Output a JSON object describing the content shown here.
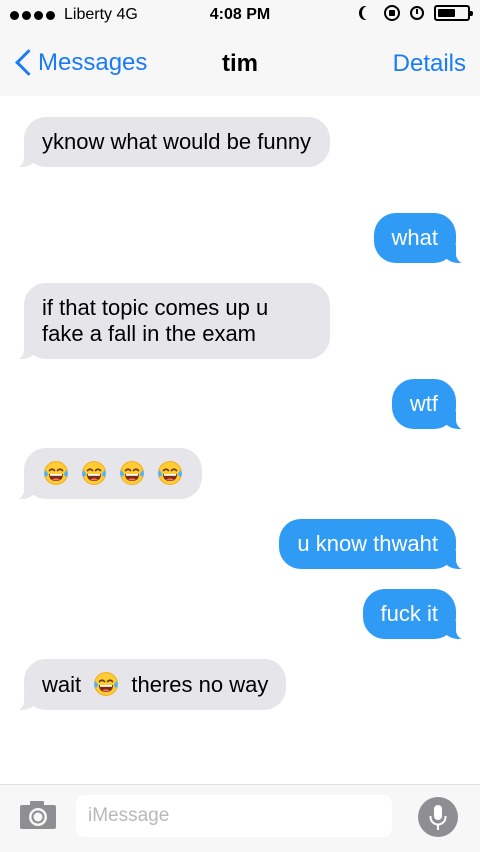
{
  "status_bar": {
    "carrier": "Liberty  4G",
    "time": "4:08 PM",
    "battery_level": 0.6,
    "icons": [
      "signal-dots-icon",
      "moon-icon",
      "rotation-lock-icon",
      "alarm-icon",
      "battery-icon"
    ]
  },
  "nav": {
    "back_label": "Messages",
    "title": "tim",
    "details_label": "Details"
  },
  "messages": [
    {
      "side": "received",
      "text": "yknow what would be funny"
    },
    {
      "side": "sent",
      "text": "what"
    },
    {
      "side": "received",
      "text": "if that topic comes up u fake a fall in the exam"
    },
    {
      "side": "sent",
      "text": "wtf"
    },
    {
      "side": "received",
      "emoji": [
        "face-with-tears-of-joy",
        "face-with-tears-of-joy",
        "face-with-tears-of-joy",
        "face-with-tears-of-joy"
      ]
    },
    {
      "side": "sent",
      "text": "u know thwaht"
    },
    {
      "side": "sent",
      "text": "fuck it"
    },
    {
      "side": "received",
      "text_before": "wait",
      "emoji": [
        "face-with-tears-of-joy"
      ],
      "text_after": "theres no way"
    }
  ],
  "input": {
    "placeholder": "iMessage"
  },
  "colors": {
    "accent": "#1a7cf5",
    "sent_bubble": "#2f9bf4",
    "received_bubble": "#e5e5ea",
    "bar_background": "#f7f7f7"
  }
}
